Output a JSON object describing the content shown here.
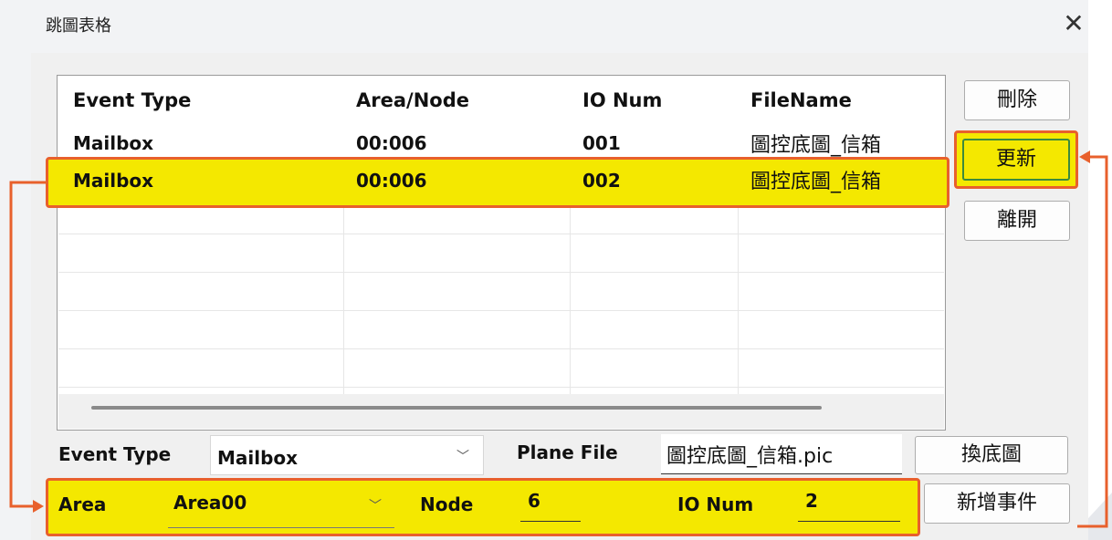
{
  "window": {
    "title": "跳圖表格"
  },
  "table": {
    "columns": [
      "Event Type",
      "Area/Node",
      "IO Num",
      "FileName"
    ],
    "rows": [
      [
        "Mailbox",
        "00:006",
        "001",
        "圖控底圖_信箱"
      ],
      [
        "Mailbox",
        "00:006",
        "002",
        "圖控底圖_信箱"
      ]
    ]
  },
  "buttons": {
    "delete": "刪除",
    "update": "更新",
    "exit": "離開",
    "change_background": "換底圖",
    "add_event": "新增事件"
  },
  "form": {
    "event_type_label": "Event Type",
    "event_type_value": "Mailbox",
    "plane_file_label": "Plane File",
    "plane_file_value": "圖控底圖_信箱.pic",
    "area_label": "Area",
    "area_value": "Area00",
    "node_label": "Node",
    "node_value": "6",
    "io_num_label": "IO Num",
    "io_num_value": "2"
  },
  "icons": {
    "close": "close-icon",
    "dropdown": "chevron-down-icon"
  },
  "colors": {
    "highlight": "#f4e800",
    "annotation": "#e8602c",
    "update_border": "#3c8a3c"
  }
}
